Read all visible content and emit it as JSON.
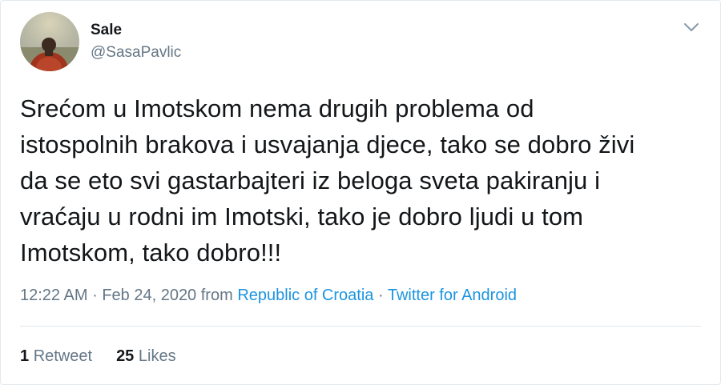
{
  "user": {
    "display_name": "Sale",
    "handle": "@SasaPavlic",
    "avatar_icon": "profile-photo"
  },
  "menu_icon": "chevron-down-icon",
  "tweet": {
    "text": "Srećom u Imotskom nema drugih problema od\nistospolnih brakova i usvajanja djece, tako se dobro živi\nda se eto svi gastarbajteri iz beloga sveta pakiranju i\nvraćaju u rodni im Imotski, tako je dobro ljudi u tom\nImotskom, tako dobro!!!"
  },
  "meta": {
    "time": "12:22 AM",
    "separator": "·",
    "date": "Feb 24, 2020",
    "from_label": "from",
    "location": "Republic of Croatia",
    "separator2": "·",
    "source": "Twitter for Android"
  },
  "stats": {
    "retweets_count": "1",
    "retweets_label": "Retweet",
    "likes_count": "25",
    "likes_label": "Likes"
  },
  "colors": {
    "link": "#1b95e0",
    "secondary_text": "#657786",
    "border": "#e1e8ed"
  }
}
